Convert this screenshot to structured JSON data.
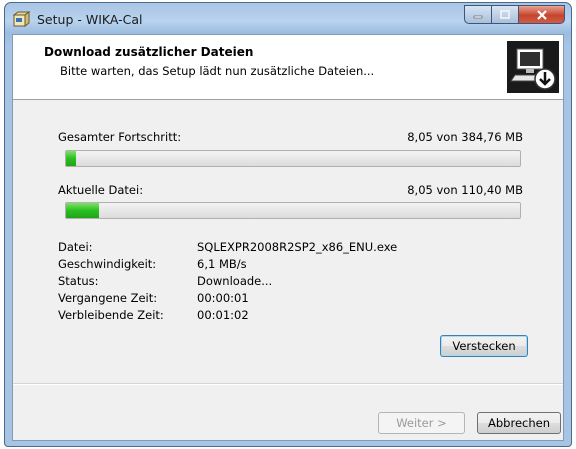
{
  "window": {
    "title": "Setup - WIKA-Cal"
  },
  "header": {
    "title": "Download zusätzlicher Dateien",
    "subtitle": "Bitte warten, das Setup lädt nun zusätzliche Dateien..."
  },
  "progress": {
    "total_label": "Gesamter Fortschritt:",
    "total_value": "8,05 von 384,76 MB",
    "total_fraction": 0.021,
    "file_label": "Aktuelle Datei:",
    "file_value": "8,05 von 110,40 MB",
    "file_fraction": 0.073
  },
  "details": [
    {
      "key": "Datei:",
      "value": "SQLEXPR2008R2SP2_x86_ENU.exe"
    },
    {
      "key": "Geschwindigkeit:",
      "value": "6,1 MB/s"
    },
    {
      "key": "Status:",
      "value": "Downloade..."
    },
    {
      "key": "Vergangene Zeit:",
      "value": "00:00:01"
    },
    {
      "key": "Verbleibende Zeit:",
      "value": "00:01:02"
    }
  ],
  "buttons": {
    "hide": "Verstecken",
    "next": "Weiter >",
    "cancel": "Abbrechen"
  },
  "icons": {
    "app": "setup-box-icon",
    "header": "computer-download-icon"
  }
}
